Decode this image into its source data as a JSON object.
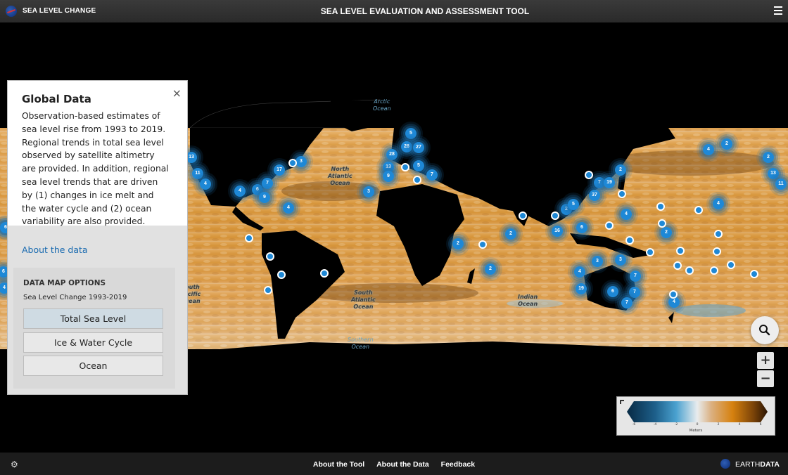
{
  "header": {
    "brand": "SEA LEVEL CHANGE",
    "title": "SEA LEVEL EVALUATION AND ASSESSMENT TOOL",
    "logo_icon": "nasa-logo-icon",
    "menu_icon": "hamburger-menu-icon"
  },
  "panel": {
    "title": "Global Data",
    "close_icon": "×",
    "description": "Observation-based estimates of sea level rise from 1993 to 2019. Regional trends in total sea level observed by satellite altimetry are provided. In addition, regional sea level trends that are driven by (1) changes in ice melt and the water cycle and (2) ocean variability are also provided.",
    "link": "About the data",
    "options": {
      "title": "DATA MAP OPTIONS",
      "subtitle": "Sea Level Change 1993-2019",
      "buttons": [
        {
          "label": "Total Sea Level",
          "active": true
        },
        {
          "label": "Ice & Water Cycle",
          "active": false
        },
        {
          "label": "Ocean",
          "active": false
        }
      ]
    }
  },
  "map": {
    "ocean_labels": [
      {
        "text": "Arctic\nOcean",
        "style": "light"
      },
      {
        "text": "North\nAtlantic\nOcean",
        "style": "dark"
      },
      {
        "text": "South\nAtlantic\nOcean",
        "style": "dark"
      },
      {
        "text": "Indian\nOcean",
        "style": "dark"
      },
      {
        "text": "Southern\nOcean",
        "style": "light"
      },
      {
        "text": "South\nPacific\nOcean",
        "style": "dark"
      }
    ],
    "clusters": [
      "13",
      "11",
      "4",
      "17",
      "3",
      "4",
      "6",
      "7",
      "9",
      "4",
      "3",
      "5",
      "28",
      "27",
      "28",
      "13",
      "9",
      "5",
      "7",
      "2",
      "2",
      "2",
      "2",
      "16",
      "6",
      "5",
      "2",
      "7",
      "19",
      "37",
      "4",
      "2",
      "3",
      "4",
      "3",
      "7",
      "19",
      "6",
      "7",
      "7",
      "4",
      "4",
      "2",
      "2",
      "13",
      "11",
      "4",
      "5",
      "6",
      "4",
      "6"
    ],
    "point_count": 28
  },
  "controls": {
    "search_icon": "magnifier-icon",
    "zoom_in": "+",
    "zoom_out": "−"
  },
  "legend": {
    "ticks": [
      "-6",
      "-4",
      "-2",
      "0",
      "2",
      "4",
      "6"
    ],
    "unit": "Meters",
    "colors": [
      "#072a44",
      "#4aa1cf",
      "#e8ecee",
      "#d6810f",
      "#2a1402"
    ]
  },
  "footer": {
    "settings_icon": "gear-icon",
    "links": [
      "About the Tool",
      "About the Data",
      "Feedback"
    ],
    "brand_prefix": "EARTH",
    "brand_suffix": "DATA"
  }
}
